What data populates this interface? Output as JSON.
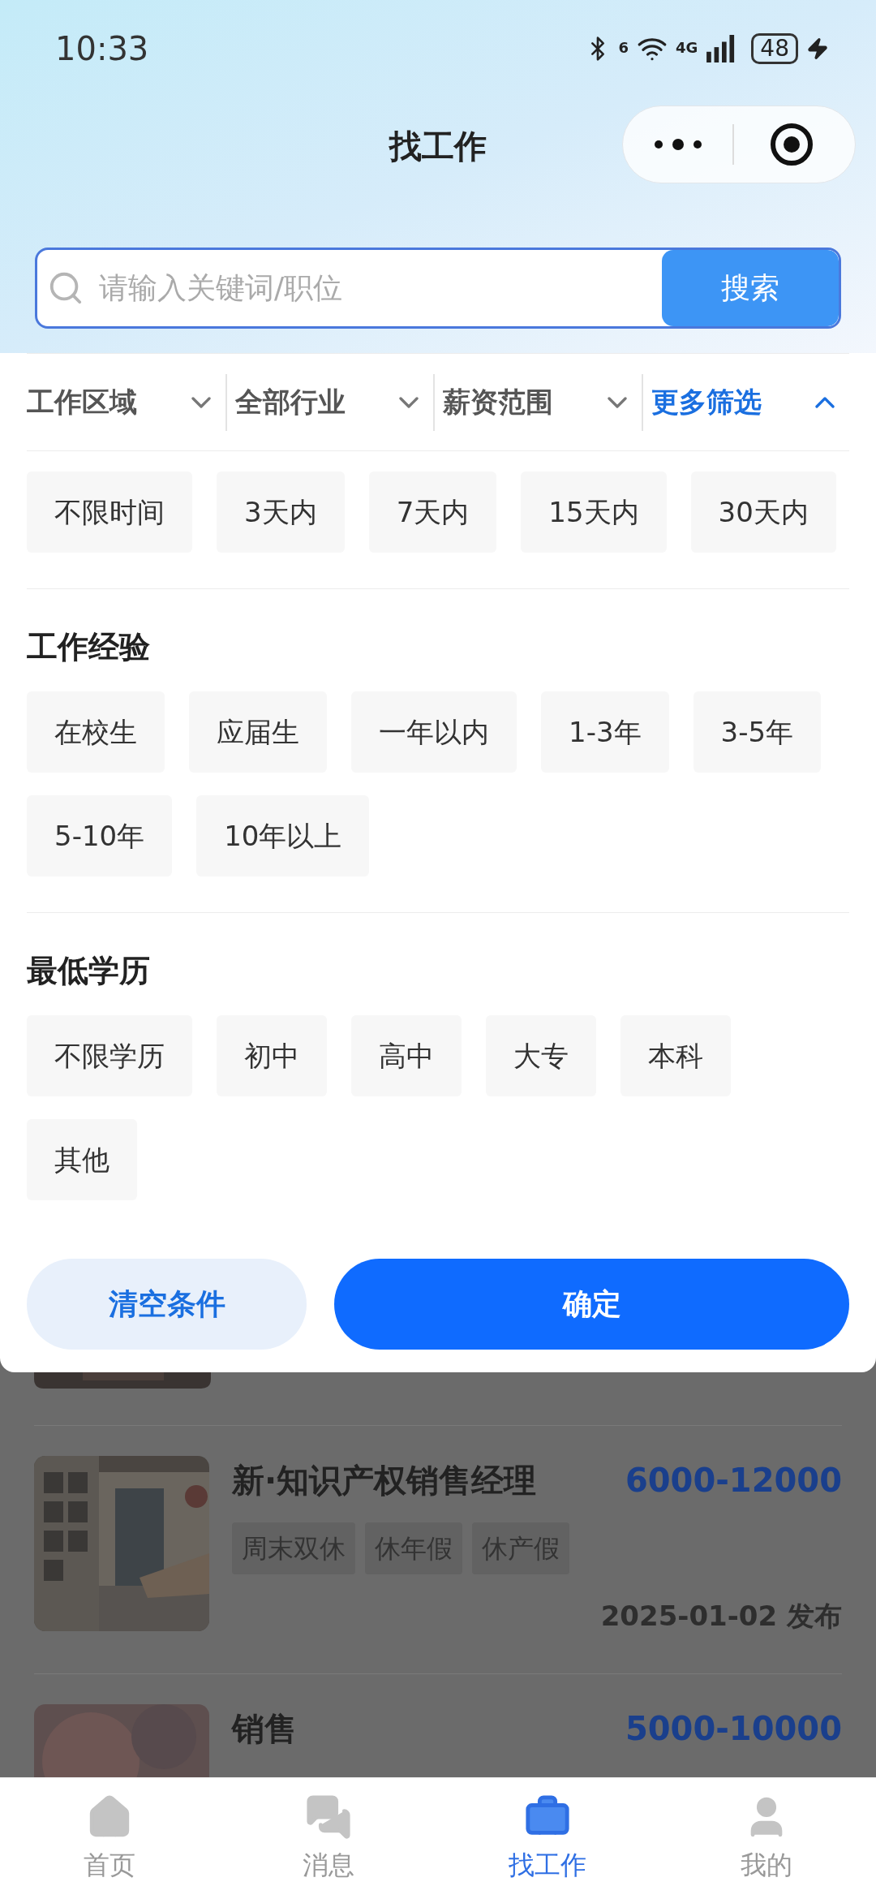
{
  "status_bar": {
    "time": "10:33",
    "wifi_badge": "6",
    "network": "4G",
    "battery": "48"
  },
  "header": {
    "title": "找工作"
  },
  "search": {
    "placeholder": "请输入关键词/职位",
    "button": "搜索"
  },
  "filter_tabs": [
    {
      "label": "工作区域",
      "selected": false,
      "expanded": false
    },
    {
      "label": "全部行业",
      "selected": false,
      "expanded": false
    },
    {
      "label": "薪资范围",
      "selected": false,
      "expanded": false
    },
    {
      "label": "更多筛选",
      "selected": true,
      "expanded": true
    }
  ],
  "filter_panel": {
    "time_options": [
      {
        "label": "不限时间",
        "selected": false
      },
      {
        "label": "3天内",
        "selected": false
      },
      {
        "label": "7天内",
        "selected": false
      },
      {
        "label": "15天内",
        "selected": false
      },
      {
        "label": "30天内",
        "selected": false
      }
    ],
    "sections": [
      {
        "title": "工作经验",
        "options": [
          {
            "label": "在校生",
            "selected": false
          },
          {
            "label": "应届生",
            "selected": false
          },
          {
            "label": "一年以内",
            "selected": false
          },
          {
            "label": "1-3年",
            "selected": false
          },
          {
            "label": "3-5年",
            "selected": false
          },
          {
            "label": "5-10年",
            "selected": false
          },
          {
            "label": "10年以上",
            "selected": false
          }
        ]
      },
      {
        "title": "最低学历",
        "options": [
          {
            "label": "不限学历",
            "selected": false
          },
          {
            "label": "初中",
            "selected": false
          },
          {
            "label": "高中",
            "selected": false
          },
          {
            "label": "大专",
            "selected": false
          },
          {
            "label": "本科",
            "selected": false
          },
          {
            "label": "其他",
            "selected": false
          }
        ]
      }
    ],
    "clear_button": "清空条件",
    "confirm_button": "确定"
  },
  "jobs": [
    {
      "title": "新·知识产权销售经理",
      "salary": "6000-12000",
      "tags": [
        "周末双休",
        "休年假",
        "休产假"
      ],
      "date": "2025-01-02 发布"
    },
    {
      "title": "销售",
      "salary": "5000-10000"
    }
  ],
  "nav": [
    {
      "label": "首页",
      "kind": "home",
      "selected": false
    },
    {
      "label": "消息",
      "kind": "chat",
      "selected": false
    },
    {
      "label": "找工作",
      "kind": "briefcase",
      "selected": true
    },
    {
      "label": "我的",
      "kind": "user",
      "selected": false
    }
  ]
}
